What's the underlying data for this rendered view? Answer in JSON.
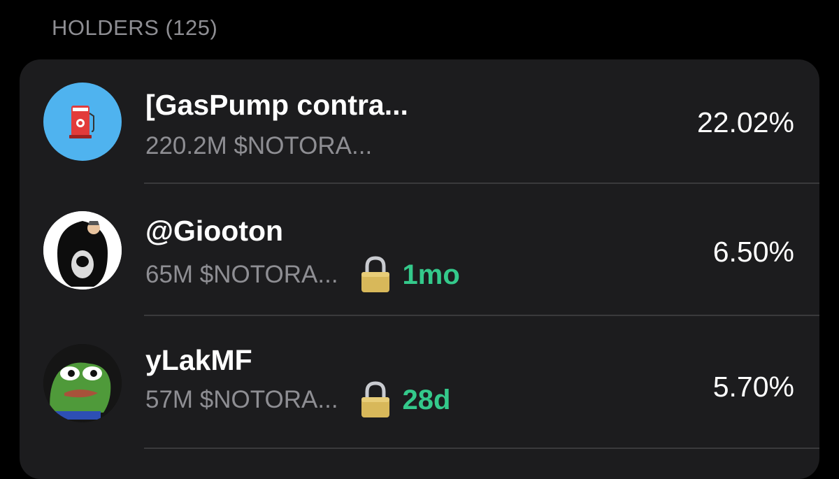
{
  "section": {
    "title": "HOLDERS (125)"
  },
  "holders": [
    {
      "name": "[GasPump contra...",
      "amount": "220.2M $NOTORA...",
      "percent": "22.02%",
      "avatar_icon": "gas-pump-icon"
    },
    {
      "name": "@Giooton",
      "amount": "65M $NOTORA...",
      "lock": "1mo",
      "percent": "6.50%",
      "avatar_icon": "hooded-figure-avatar"
    },
    {
      "name": "yLakMF",
      "amount": "57M $NOTORA...",
      "lock": "28d",
      "percent": "5.70%",
      "avatar_icon": "frog-avatar"
    }
  ],
  "colors": {
    "background": "#000000",
    "card": "#1c1c1e",
    "secondary_text": "#8e8e93",
    "lock_green": "#34c98b",
    "divider": "#3a3a3c"
  }
}
